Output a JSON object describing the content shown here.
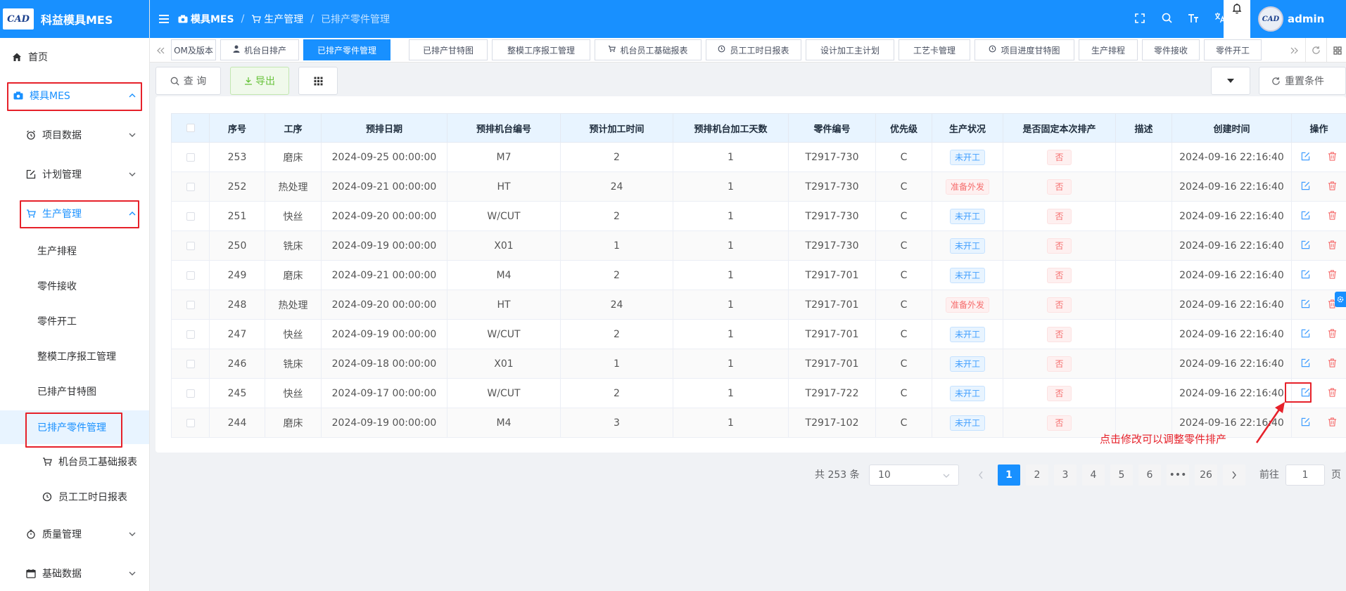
{
  "app": {
    "logo_text": "CAD",
    "title": "科益模具MES"
  },
  "header": {
    "breadcrumb": [
      "模具MES",
      "生产管理",
      "已排产零件管理"
    ],
    "user": "admin",
    "avatar_text": "CAD"
  },
  "sidebar": {
    "home": "首页",
    "mold_mes": "模具MES",
    "project_data": "项目数据",
    "plan_mgmt": "计划管理",
    "production_mgmt": "生产管理",
    "sub_items": [
      "生产排程",
      "零件接收",
      "零件开工",
      "整模工序报工管理",
      "已排产甘特图",
      "已排产零件管理",
      "机台员工基础报表",
      "员工工时日报表"
    ],
    "quality_mgmt": "质量管理",
    "basic_data": "基础数据"
  },
  "tabs": [
    "OM及版本",
    "机台日排产",
    "已排产零件管理",
    "已排产甘特图",
    "整模工序报工管理",
    "机台员工基础报表",
    "员工工时日报表",
    "设计加工主计划",
    "工艺卡管理",
    "项目进度甘特图",
    "生产排程",
    "零件接收",
    "零件开工"
  ],
  "toolbar": {
    "query": "查 询",
    "export": "导出",
    "reset": "重置条件"
  },
  "table": {
    "columns": [
      "序号",
      "工序",
      "预排日期",
      "预排机台编号",
      "预计加工时间",
      "预排机台加工天数",
      "零件编号",
      "优先级",
      "生产状况",
      "是否固定本次排产",
      "描述",
      "创建时间",
      "操作"
    ],
    "rows": [
      [
        "253",
        "磨床",
        "2024-09-25 00:00:00",
        "M7",
        "2",
        "1",
        "T2917-730",
        "C",
        "未开工",
        "否",
        "",
        "2024-09-16 22:16:40"
      ],
      [
        "252",
        "热处理",
        "2024-09-21 00:00:00",
        "HT",
        "24",
        "1",
        "T2917-730",
        "C",
        "准备外发",
        "否",
        "",
        "2024-09-16 22:16:40"
      ],
      [
        "251",
        "快丝",
        "2024-09-20 00:00:00",
        "W/CUT",
        "2",
        "1",
        "T2917-730",
        "C",
        "未开工",
        "否",
        "",
        "2024-09-16 22:16:40"
      ],
      [
        "250",
        "铣床",
        "2024-09-19 00:00:00",
        "X01",
        "1",
        "1",
        "T2917-730",
        "C",
        "未开工",
        "否",
        "",
        "2024-09-16 22:16:40"
      ],
      [
        "249",
        "磨床",
        "2024-09-21 00:00:00",
        "M4",
        "2",
        "1",
        "T2917-701",
        "C",
        "未开工",
        "否",
        "",
        "2024-09-16 22:16:40"
      ],
      [
        "248",
        "热处理",
        "2024-09-20 00:00:00",
        "HT",
        "24",
        "1",
        "T2917-701",
        "C",
        "准备外发",
        "否",
        "",
        "2024-09-16 22:16:40"
      ],
      [
        "247",
        "快丝",
        "2024-09-19 00:00:00",
        "W/CUT",
        "2",
        "1",
        "T2917-701",
        "C",
        "未开工",
        "否",
        "",
        "2024-09-16 22:16:40"
      ],
      [
        "246",
        "铣床",
        "2024-09-18 00:00:00",
        "X01",
        "1",
        "1",
        "T2917-701",
        "C",
        "未开工",
        "否",
        "",
        "2024-09-16 22:16:40"
      ],
      [
        "245",
        "快丝",
        "2024-09-17 00:00:00",
        "W/CUT",
        "2",
        "1",
        "T2917-722",
        "C",
        "未开工",
        "否",
        "",
        "2024-09-16 22:16:40"
      ],
      [
        "244",
        "磨床",
        "2024-09-19 00:00:00",
        "M4",
        "3",
        "1",
        "T2917-102",
        "C",
        "未开工",
        "否",
        "",
        "2024-09-16 22:16:40"
      ]
    ]
  },
  "pagination": {
    "total": "共 253 条",
    "page_size": "10",
    "pages": [
      "1",
      "2",
      "3",
      "4",
      "5",
      "6",
      "•••",
      "26"
    ],
    "goto_prefix": "前往",
    "goto_value": "1",
    "goto_suffix": "页"
  },
  "annotation": "点击修改可以调整零件排产",
  "colors": {
    "primary": "#1890ff",
    "annotation_red": "#e6212a",
    "tag_blue": "#409eff",
    "tag_red": "#f56c6c"
  }
}
